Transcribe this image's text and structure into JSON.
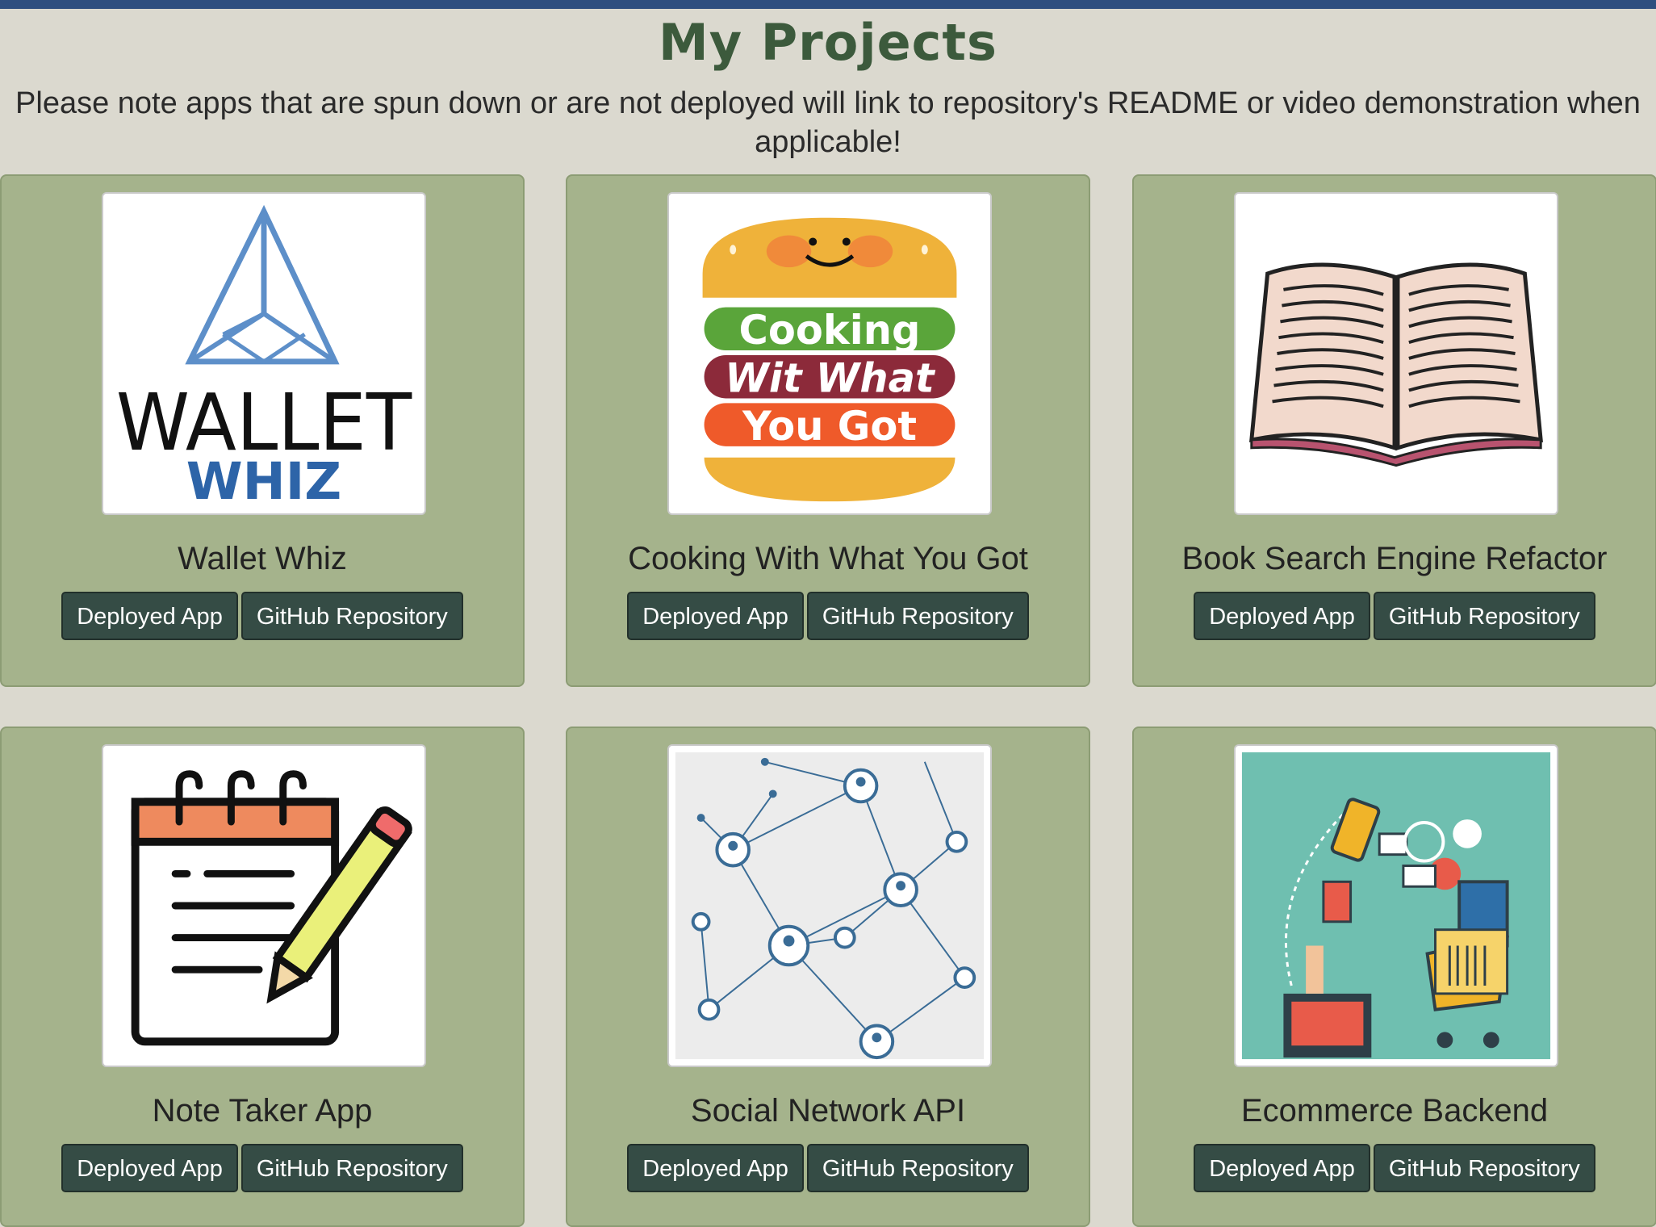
{
  "page": {
    "title": "My Projects",
    "note": "Please note apps that are spun down or are not deployed will link to repository's README or video demonstration when applicable!"
  },
  "colors": {
    "background": "#dbd9cf",
    "card": "#a5b38c",
    "button": "#354c45",
    "title": "#3c5a3c",
    "topbar": "#2f4f7f"
  },
  "projects": [
    {
      "title": "Wallet Whiz",
      "image_icon": "wallet-whiz-logo",
      "logo_text": [
        "WALLET",
        "WHIZ"
      ],
      "deployed_label": "Deployed App",
      "repo_label": "GitHub Repository"
    },
    {
      "title": "Cooking With What You Got",
      "image_icon": "burger-logo",
      "logo_text": [
        "Cooking",
        "Wit What",
        "You Got"
      ],
      "deployed_label": "Deployed App",
      "repo_label": "GitHub Repository"
    },
    {
      "title": "Book Search Engine Refactor",
      "image_icon": "open-book-icon",
      "deployed_label": "Deployed App",
      "repo_label": "GitHub Repository"
    },
    {
      "title": "Note Taker App",
      "image_icon": "notepad-pencil-icon",
      "deployed_label": "Deployed App",
      "repo_label": "GitHub Repository"
    },
    {
      "title": "Social Network API",
      "image_icon": "network-graph-icon",
      "deployed_label": "Deployed App",
      "repo_label": "GitHub Repository"
    },
    {
      "title": "Ecommerce Backend",
      "image_icon": "ecommerce-illustration",
      "deployed_label": "Deployed App",
      "repo_label": "GitHub Repository"
    }
  ]
}
